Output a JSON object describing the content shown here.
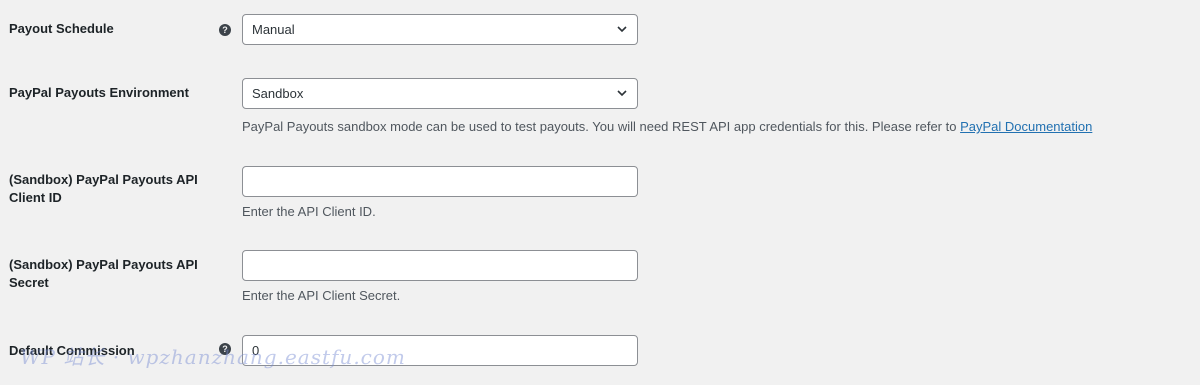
{
  "fields": [
    {
      "label": "Payout Schedule",
      "has_help": true,
      "type": "select",
      "value": "Manual"
    },
    {
      "label": "PayPal Payouts Environment",
      "has_help": false,
      "type": "select",
      "value": "Sandbox",
      "description": "PayPal Payouts sandbox mode can be used to test payouts. You will need REST API app credentials for this. Please refer to",
      "description_link": "PayPal Documentation"
    },
    {
      "label": "(Sandbox) PayPal Payouts API Client ID",
      "has_help": false,
      "type": "text",
      "value": "",
      "description": "Enter the API Client ID."
    },
    {
      "label": "(Sandbox) PayPal Payouts API Secret",
      "has_help": false,
      "type": "text",
      "value": "",
      "description": "Enter the API Client Secret."
    },
    {
      "label": "Default Commission",
      "has_help": true,
      "type": "text",
      "value": "0"
    }
  ],
  "help_glyph": "?",
  "watermark": "WP 站长 · wpzhanzhang.eastfu.com",
  "colors": {
    "background": "#f1f1f1",
    "link": "#2271b1",
    "border": "#8c8f94"
  }
}
